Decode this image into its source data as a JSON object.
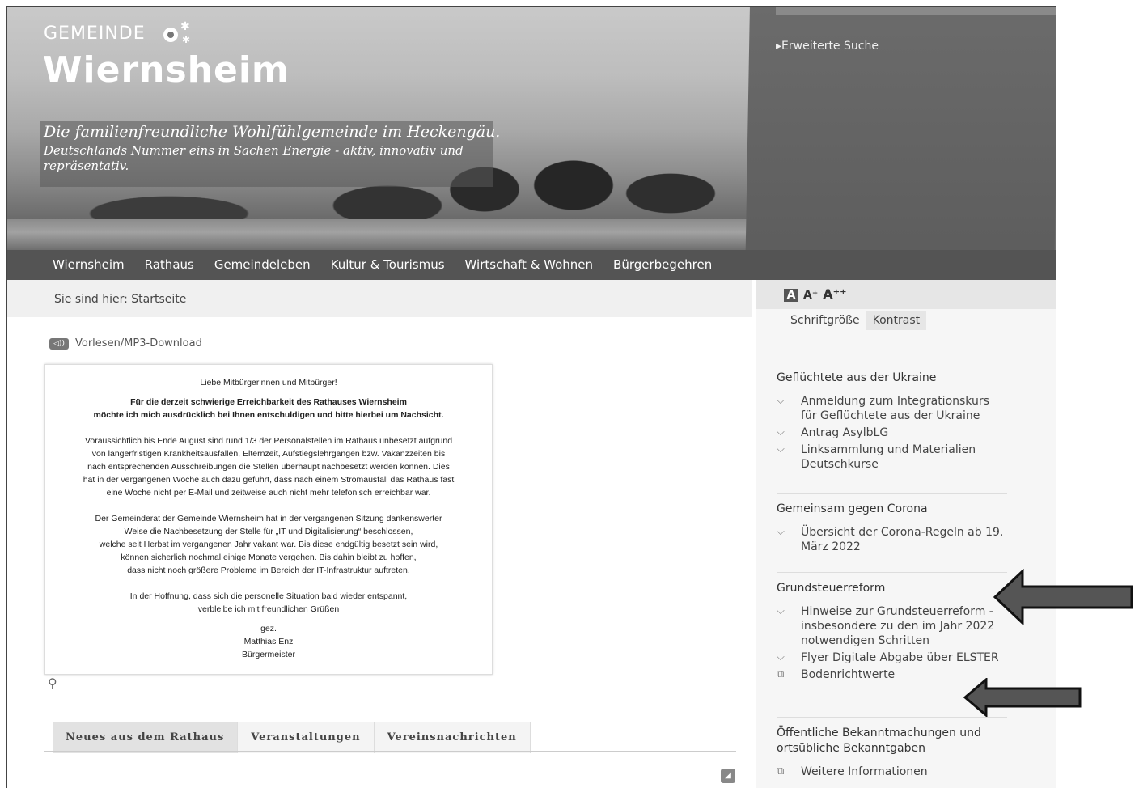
{
  "header": {
    "logo_small": "Gemeinde",
    "logo_big": "Wiernsheim",
    "tagline1": "Die familienfreundliche Wohlfühlgemeinde im Heckengäu.",
    "tagline2": "Deutschlands Nummer eins in Sachen Energie - aktiv, innovativ und repräsentativ.",
    "extended_search": "Erweiterte Suche"
  },
  "nav": [
    "Wiernsheim",
    "Rathaus",
    "Gemeindeleben",
    "Kultur & Tourismus",
    "Wirtschaft & Wohnen",
    "Bürgerbegehren"
  ],
  "breadcrumb": "Sie sind hier: Startseite",
  "audio_label": "Vorlesen/MP3-Download",
  "letter": {
    "greeting": "Liebe Mitbürgerinnen und Mitbürger!",
    "bold1": "Für die derzeit schwierige Erreichbarkeit des Rathauses Wiernsheim",
    "bold2": "möchte ich mich ausdrücklich bei Ihnen entschuldigen und bitte hierbei um Nachsicht.",
    "p1": [
      "Voraussichtlich bis Ende August sind rund 1/3 der Personalstellen im Rathaus unbesetzt aufgrund",
      "von längerfristigen Krankheitsausfällen, Elternzeit, Aufstiegslehrgängen bzw. Vakanzzeiten bis",
      "nach entsprechenden Ausschreibungen die Stellen überhaupt nachbesetzt werden können. Dies",
      "hat in der vergangenen Woche auch dazu geführt, dass nach einem Stromausfall das Rathaus fast",
      "eine Woche nicht per E-Mail und zeitweise auch nicht mehr telefonisch erreichbar war."
    ],
    "p2": [
      "Der Gemeinderat der Gemeinde Wiernsheim hat in der vergangenen Sitzung dankenswerter",
      "Weise die Nachbesetzung der Stelle für „IT und Digitalisierung“ beschlossen,",
      "welche seit Herbst im vergangenen Jahr vakant war. Bis diese endgültig besetzt sein wird,",
      "können sicherlich nochmal einige Monate vergehen. Bis dahin bleibt zu hoffen,",
      "dass nicht noch größere Probleme im Bereich der IT-Infrastruktur auftreten."
    ],
    "p3": [
      "In der Hoffnung, dass sich die personelle Situation bald wieder entspannt,",
      "verbleibe ich mit freundlichen Grüßen"
    ],
    "sig": [
      "gez.",
      "Matthias Enz",
      "Bürgermeister"
    ]
  },
  "tabs": [
    "Neues aus dem Rathaus",
    "Veranstaltungen",
    "Vereinsnachrichten"
  ],
  "font_size": {
    "a1": "A",
    "a2": "A⁺",
    "a3": "A⁺⁺",
    "label": "Schriftgröße",
    "contrast": "Kontrast"
  },
  "sidebar": {
    "sec1_title": "Geflüchtete aus der Ukraine",
    "sec1_links": [
      "Anmeldung zum Integrationskurs für Geflüchtete aus der Ukraine",
      "Antrag AsylbLG",
      "Linksammlung und Materialien Deutschkurse"
    ],
    "sec2_title": "Gemeinsam gegen Corona",
    "sec2_links": [
      "Übersicht der Corona-Regeln ab 19. März 2022"
    ],
    "sec3_title": "Grundsteuerreform",
    "sec3_links": [
      "Hinweise zur Grundsteuerreform - insbesondere zu den im Jahr 2022 notwendigen Schritten",
      "Flyer Digitale Abgabe über ELSTER",
      "Bodenrichtwerte"
    ],
    "sec4_title": "Öffentliche Bekanntmachungen und ortsübliche Bekanntgaben",
    "sec4_links": [
      "Weitere Informationen"
    ]
  }
}
